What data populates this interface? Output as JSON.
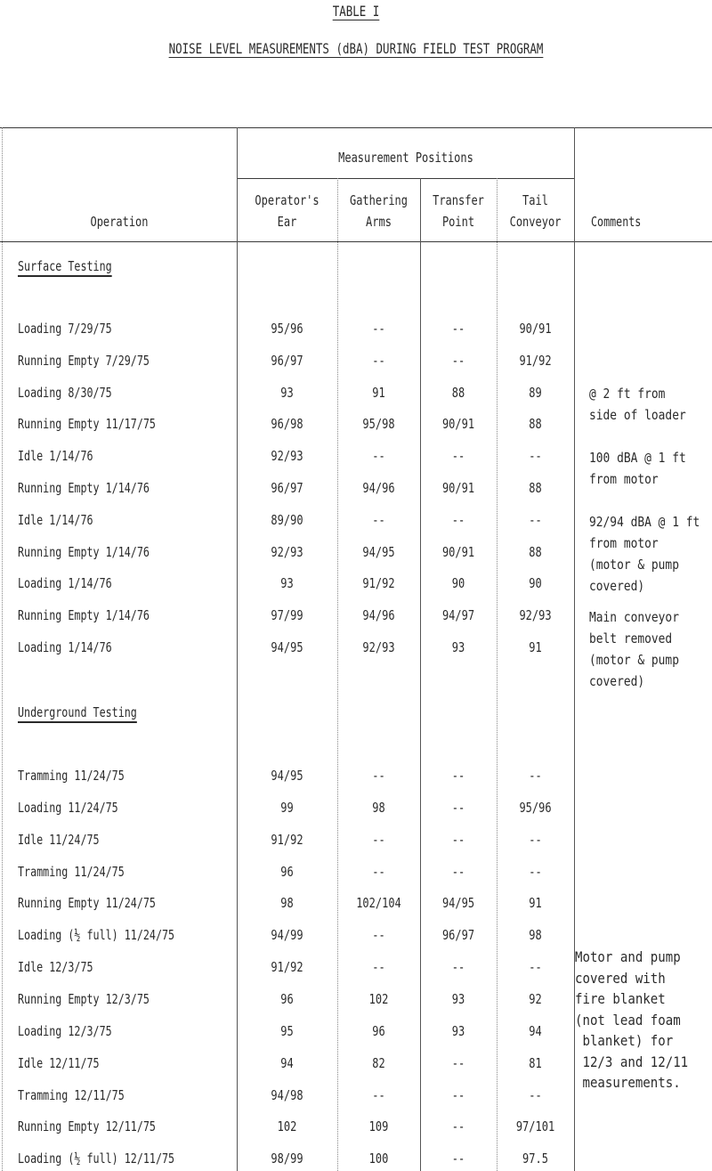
{
  "document": {
    "table_number": "TABLE I",
    "caption": "NOISE LEVEL MEASUREMENTS (dBA) DURING FIELD TEST PROGRAM"
  },
  "header": {
    "operation": "Operation",
    "group": "Measurement Positions",
    "columns": [
      {
        "line1": "Operator's",
        "line2": "Ear"
      },
      {
        "line1": "Gathering",
        "line2": "Arms"
      },
      {
        "line1": "Transfer",
        "line2": "Point"
      },
      {
        "line1": "Tail",
        "line2": "Conveyor"
      }
    ],
    "comments": "Comments"
  },
  "sections": [
    {
      "title": "Surface Testing",
      "rows": [
        {
          "operation": "Loading 7/29/75",
          "values": [
            "95/96",
            "--",
            "--",
            "90/91"
          ]
        },
        {
          "operation": "Running Empty 7/29/75",
          "values": [
            "96/97",
            "--",
            "--",
            "91/92"
          ]
        },
        {
          "operation": "Loading 8/30/75",
          "values": [
            "93",
            "91",
            "88",
            "89"
          ]
        },
        {
          "operation": "Running Empty 11/17/75",
          "values": [
            "96/98",
            "95/98",
            "90/91",
            "88"
          ]
        },
        {
          "operation": "Idle 1/14/76",
          "values": [
            "92/93",
            "--",
            "--",
            "--"
          ]
        },
        {
          "operation": "Running Empty 1/14/76",
          "values": [
            "96/97",
            "94/96",
            "90/91",
            "88"
          ]
        },
        {
          "operation": "Idle 1/14/76",
          "values": [
            "89/90",
            "--",
            "--",
            "--"
          ]
        },
        {
          "operation": "Running Empty 1/14/76",
          "values": [
            "92/93",
            "94/95",
            "90/91",
            "88"
          ]
        },
        {
          "operation": "Loading 1/14/76",
          "values": [
            "93",
            "91/92",
            "90",
            "90"
          ]
        },
        {
          "operation": "Running Empty 1/14/76",
          "values": [
            "97/99",
            "94/96",
            "94/97",
            "92/93"
          ]
        },
        {
          "operation": "Loading 1/14/76",
          "values": [
            "94/95",
            "92/93",
            "93",
            "91"
          ]
        }
      ],
      "comments": [
        "@ 2 ft from\nside of loader",
        "100 dBA @ 1 ft\nfrom motor",
        "92/94 dBA @ 1 ft\nfrom motor\n(motor & pump\ncovered)",
        "Main conveyor\nbelt removed\n(motor & pump\ncovered)"
      ]
    },
    {
      "title": "Underground Testing",
      "rows": [
        {
          "operation": "Tramming 11/24/75",
          "values": [
            "94/95",
            "--",
            "--",
            "--"
          ]
        },
        {
          "operation": "Loading 11/24/75",
          "values": [
            "99",
            "98",
            "--",
            "95/96"
          ]
        },
        {
          "operation": "Idle 11/24/75",
          "values": [
            "91/92",
            "--",
            "--",
            "--"
          ]
        },
        {
          "operation": "Tramming 11/24/75",
          "values": [
            "96",
            "--",
            "--",
            "--"
          ]
        },
        {
          "operation": "Running Empty 11/24/75",
          "values": [
            "98",
            "102/104",
            "94/95",
            "91"
          ]
        },
        {
          "operation": "Loading (½ full) 11/24/75",
          "values": [
            "94/99",
            "--",
            "96/97",
            "98"
          ]
        },
        {
          "operation": "Idle 12/3/75",
          "values": [
            "91/92",
            "--",
            "--",
            "--"
          ]
        },
        {
          "operation": "Running Empty 12/3/75",
          "values": [
            "96",
            "102",
            "93",
            "92"
          ]
        },
        {
          "operation": "Loading 12/3/75",
          "values": [
            "95",
            "96",
            "93",
            "94"
          ]
        },
        {
          "operation": "Idle 12/11/75",
          "values": [
            "94",
            "82",
            "--",
            "81"
          ]
        },
        {
          "operation": "Tramming 12/11/75",
          "values": [
            "94/98",
            "--",
            "--",
            "--"
          ]
        },
        {
          "operation": "Running Empty 12/11/75",
          "values": [
            "102",
            "109",
            "--",
            "97/101"
          ]
        },
        {
          "operation": "Loading (½ full) 12/11/75",
          "values": [
            "98/99",
            "100",
            "--",
            "97.5"
          ]
        }
      ],
      "comments": [
        "Motor and pump\ncovered with\nfire blanket\n(not lead foam\n blanket) for\n 12/3 and 12/11\n measurements."
      ]
    }
  ]
}
